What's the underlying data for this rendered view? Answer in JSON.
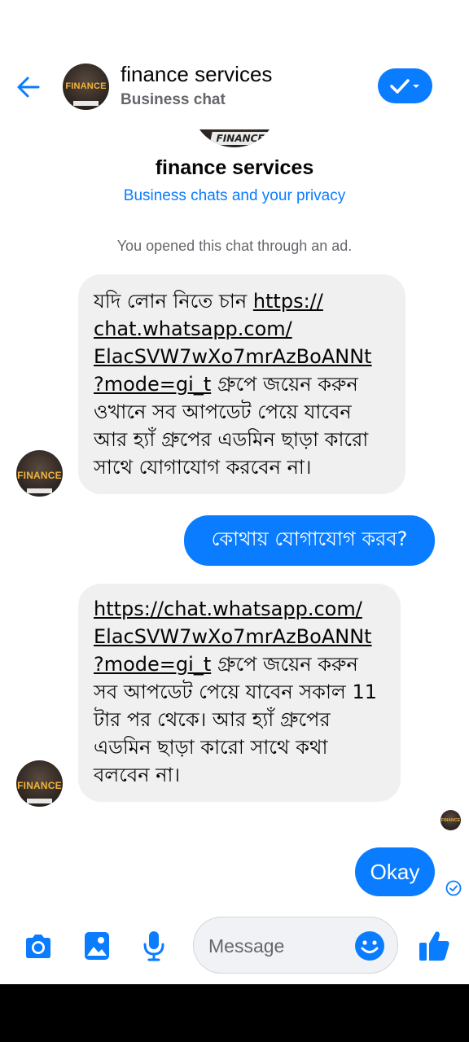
{
  "header": {
    "title": "finance services",
    "subtitle": "Business chat",
    "avatar_text": "FINANCE"
  },
  "intro": {
    "avatar_strip_text": "FINANCE",
    "name": "finance services",
    "privacy_link": "Business chats and your privacy",
    "ad_notice": "You opened this chat through an ad."
  },
  "messages": [
    {
      "sender": "business",
      "pre_text": "যদি লোন নিতে চান ",
      "link": "https://chat.whatsapp.com/ElacSVW7wXo7mrAzBoANNt?mode=gi_t",
      "link_lines": [
        "https://",
        "chat.whatsapp.com/",
        "ElacSVW7wXo7mrAzBoANNt",
        "?mode=gi_t"
      ],
      "post_text": " গ্রুপে জয়েন করুন ওখানে সব আপডেট পেয়ে যাবেন আর হ্যাঁ গ্রুপের এডমিন ছাড়া কারো সাথে যোগাযোগ করবেন না।"
    },
    {
      "sender": "me",
      "text": "কোথায় যোগাযোগ করব?"
    },
    {
      "sender": "business",
      "link": "https://chat.whatsapp.com/ElacSVW7wXo7mrAzBoANNt?mode=gi_t",
      "link_lines": [
        "https://chat.whatsapp.com/",
        "ElacSVW7wXo7mrAzBoANNt",
        "?mode=gi_t"
      ],
      "post_text": " গ্রুপে জয়েন করুন সব আপডেট পেয়ে যাবেন সকাল 11 টার পর থেকে। আর হ্যাঁ গ্রুপের এডমিন ছাড়া কারো সাথে কথা বলবেন না।"
    },
    {
      "sender": "me",
      "text": "Okay"
    }
  ],
  "composer": {
    "placeholder": "Message"
  },
  "colors": {
    "accent": "#0a7cff",
    "bubble_incoming": "#f0f0f0",
    "secondary_text": "#65676b"
  },
  "icons": [
    "back-arrow-icon",
    "check-dropdown-icon",
    "camera-icon",
    "gallery-icon",
    "microphone-icon",
    "emoji-icon",
    "thumbs-up-icon",
    "sent-check-icon"
  ]
}
